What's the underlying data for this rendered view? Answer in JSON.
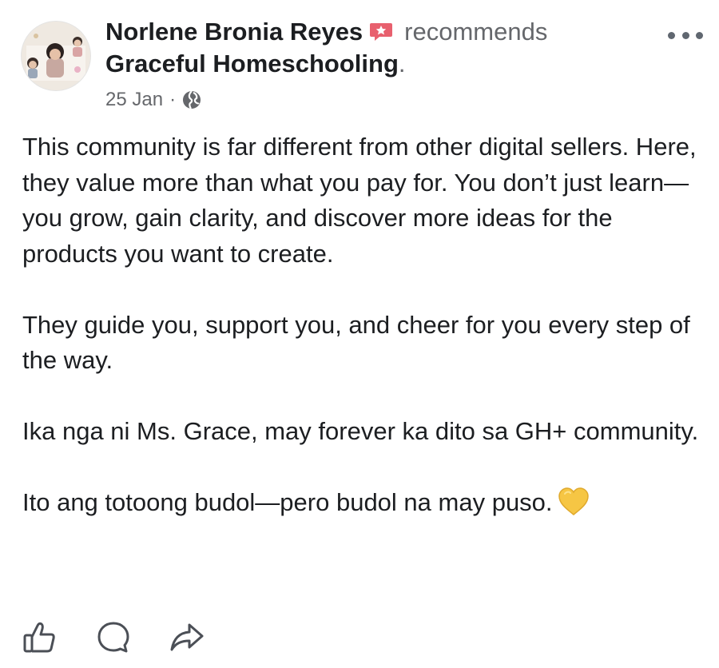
{
  "post": {
    "author": "Norlene Bronia Reyes",
    "action": "recommends",
    "page_name": "Graceful Homeschooling",
    "period": ".",
    "date": "25 Jan",
    "separator": "·",
    "privacy_icon": "globe-icon",
    "more_icon": "more-options-icon",
    "paragraphs": [
      "This community is far different from other digital sellers. Here, they value more than what you pay for. You don’t just learn—you grow, gain clarity, and discover more ideas for the products you want to create.",
      "They guide you, support you, and cheer for you every step of the way.",
      "Ika nga ni Ms. Grace, may forever ka dito sa GH+ community.",
      "Ito ang totoong budol—pero budol na may puso."
    ],
    "emoji": "yellow-heart-icon"
  },
  "actions": [
    {
      "name": "like",
      "icon": "thumbs-up-icon"
    },
    {
      "name": "comment",
      "icon": "comment-icon"
    },
    {
      "name": "share",
      "icon": "share-icon"
    }
  ],
  "colors": {
    "text": "#1c1e21",
    "secondary": "#65676b",
    "badge": "#e8606e",
    "heart": "#f6c644"
  }
}
